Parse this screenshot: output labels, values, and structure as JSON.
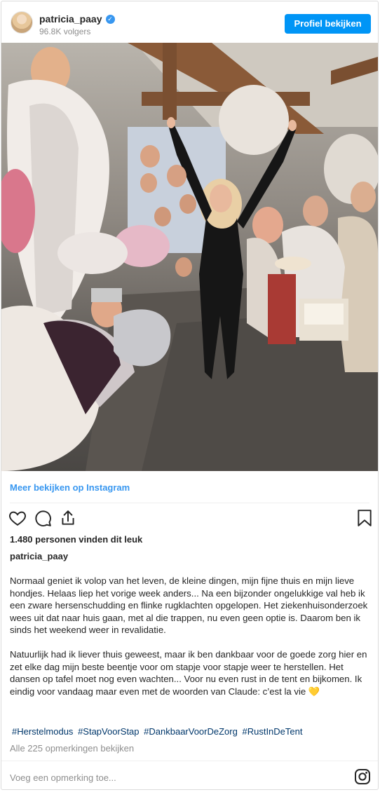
{
  "header": {
    "username": "patricia_paay",
    "verified_mark": "✓",
    "followers": "96.8K volgers",
    "profile_button": "Profiel bekijken"
  },
  "photo": {
    "subject": "photo-of-dancer-among-mannequins"
  },
  "more_link": "Meer bekijken op Instagram",
  "actions": {
    "icons": [
      "heart-icon",
      "comment-icon",
      "share-icon",
      "bookmark-icon"
    ]
  },
  "likes": "1.480 personen vinden dit leuk",
  "owner": "patricia_paay",
  "caption": {
    "p1": "Normaal geniet ik volop van het leven, de kleine dingen, mijn fijne thuis en mijn lieve hondjes. Helaas liep het vorige week anders... Na een bijzonder ongelukkige val heb ik een zware hersenschudding en flinke rugklachten opgelopen. Het ziekenhuisonderzoek wees uit dat naar huis gaan, met al die trappen, nu even geen optie is. Daarom ben ik sinds het weekend weer in revalidatie.",
    "p2": "Natuurlijk had ik liever thuis geweest, maar ik ben dankbaar voor de goede zorg hier en zet elke dag mijn beste beentje voor om stapje voor stapje weer te herstellen. Het dansen op tafel moet nog even wachten... Voor nu even rust in de tent en bijkomen. Ik eindig voor vandaag maar even met de woorden van Claude: c’est la vie 💛"
  },
  "hashtags": [
    "#Herstelmodus",
    "#StapVoorStap",
    "#DankbaarVoorDeZorg",
    "#RustInDeTent"
  ],
  "comments_link": "Alle 225 opmerkingen bekijken",
  "comment_placeholder": "Voeg een opmerking toe...",
  "colors": {
    "accent": "#0095f6",
    "link": "#3897f0",
    "hashtag": "#00376b",
    "muted": "#8e8e8e"
  }
}
